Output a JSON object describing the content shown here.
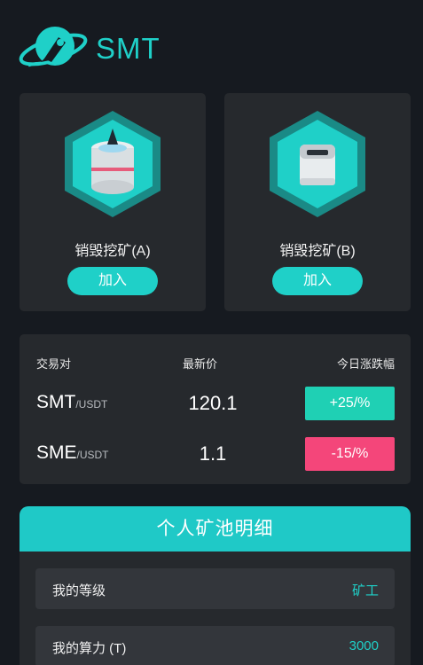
{
  "header": {
    "brand": "SMT",
    "logo_icon": "rocket-planet-logo-icon"
  },
  "mining": [
    {
      "title": "销毁挖矿(A)",
      "button": "加入",
      "icon": "mining-machine-cylinder-icon"
    },
    {
      "title": "销毁挖矿(B)",
      "button": "加入",
      "icon": "mining-machine-box-icon"
    }
  ],
  "market": {
    "headers": {
      "pair": "交易对",
      "price": "最新价",
      "change": "今日涨跌幅"
    },
    "rows": [
      {
        "base": "SMT",
        "quote": "/USDT",
        "price": "120.1",
        "change": "+25/%",
        "direction": "up"
      },
      {
        "base": "SME",
        "quote": "/USDT",
        "price": "1.1",
        "change": "-15/%",
        "direction": "down"
      }
    ]
  },
  "pool": {
    "title": "个人矿池明细",
    "rows": [
      {
        "label": "我的等级",
        "value": "矿工"
      },
      {
        "label": "我的算力 (T)",
        "value": "3000"
      }
    ]
  },
  "colors": {
    "background": "#161a20",
    "card": "#26292d",
    "accent": "#1fd0c8",
    "up": "#1fd0b4",
    "down": "#f4467a"
  }
}
